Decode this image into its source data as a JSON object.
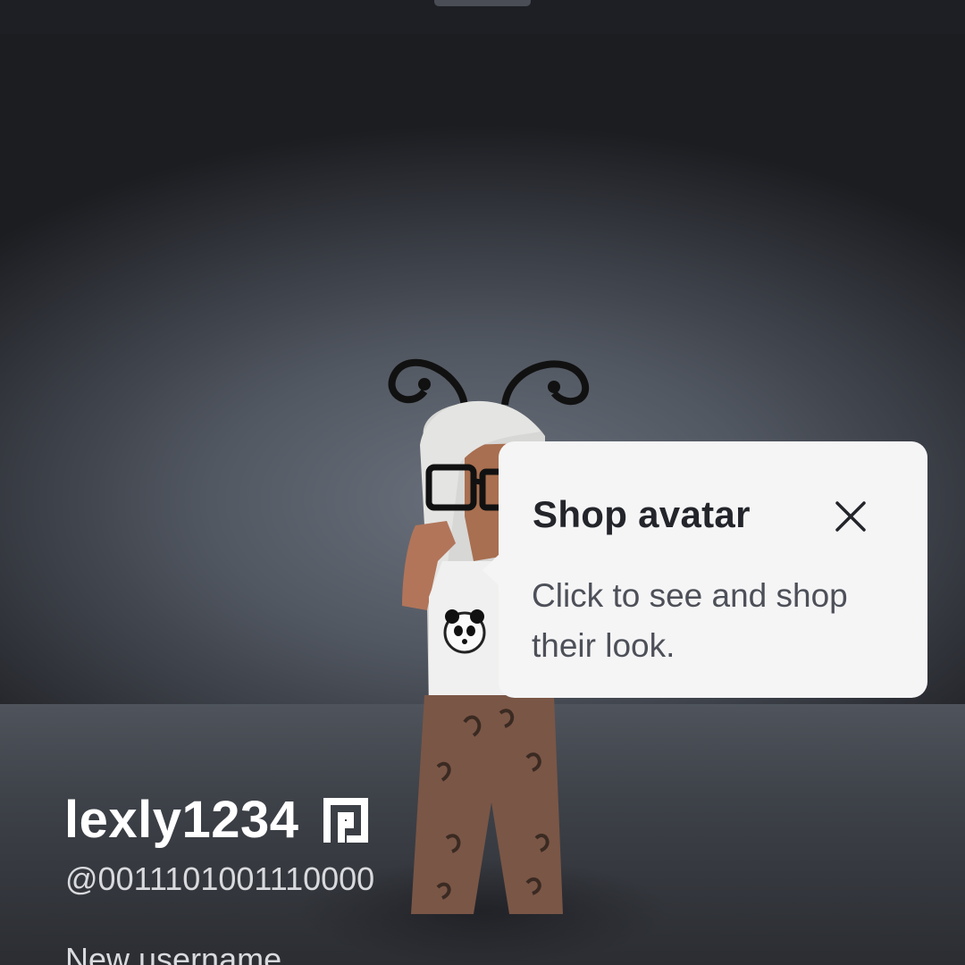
{
  "popover": {
    "title": "Shop avatar",
    "body": "Click to see and shop their look.",
    "close_icon": "close-icon"
  },
  "profile": {
    "display_name": "lexly1234",
    "premium_icon": "premium-icon",
    "handle": "@0011101001110000",
    "new_username_label": "New username"
  },
  "colors": {
    "popover_background": "#f5f5f6",
    "title_text": "#23252b",
    "body_text": "#4d5058",
    "display_name": "#ffffff"
  }
}
